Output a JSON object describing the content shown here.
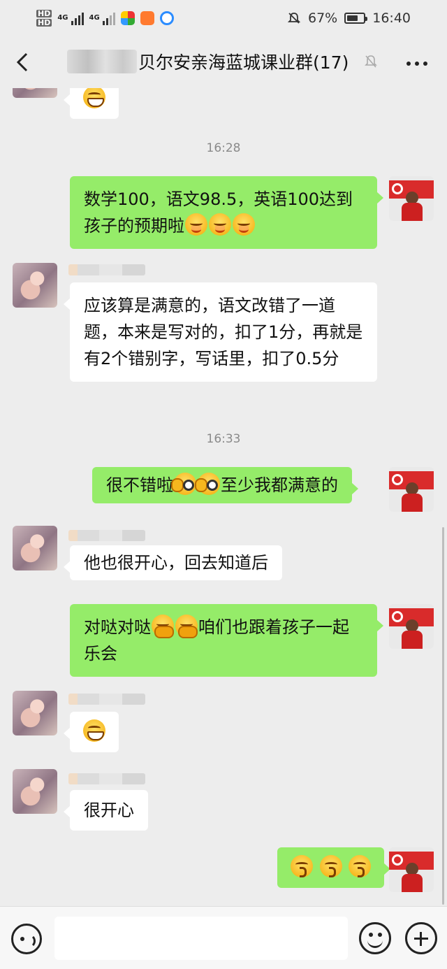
{
  "status_bar": {
    "battery": "67%",
    "time": "16:40",
    "network": "4G"
  },
  "header": {
    "title": "贝尔安亲海蓝城课业群(17)",
    "back_icon": "chevron-left-icon",
    "mute_icon": "bell-off-icon",
    "more_icon": "more-dots-icon"
  },
  "messages": [
    {
      "type": "emoji",
      "side": "in",
      "emoji": "grin"
    },
    {
      "type": "time",
      "text": "16:28"
    },
    {
      "type": "text",
      "side": "out",
      "text": "数学100，语文98.5，英语100达到孩子的预期啦",
      "emojis": [
        "smile",
        "smile",
        "smile"
      ]
    },
    {
      "type": "text",
      "side": "in",
      "text": "应该算是满意的，语文改错了一道题，本来是写对的，扣了1分，再就是有2个错别字，写话里，扣了0.5分"
    },
    {
      "type": "time",
      "text": "16:33"
    },
    {
      "type": "text",
      "side": "out",
      "text_before": "很不错啦",
      "emojis": [
        "wink",
        "wink"
      ],
      "text_after": "至少我都满意的"
    },
    {
      "type": "text",
      "side": "in",
      "text": "他也很开心，回去知道后"
    },
    {
      "type": "text",
      "side": "out",
      "text_before": "对哒对哒",
      "emojis": [
        "hug",
        "hug"
      ],
      "text_after": "咱们也跟着孩子一起乐会"
    },
    {
      "type": "emoji",
      "side": "in",
      "emoji": "grin"
    },
    {
      "type": "text",
      "side": "in",
      "text": "很开心"
    },
    {
      "type": "emoji",
      "side": "out",
      "emojis": [
        "kiss",
        "kiss",
        "kiss"
      ]
    }
  ],
  "input_bar": {
    "voice_icon": "voice-icon",
    "emoji_icon": "emoji-face-icon",
    "plus_icon": "plus-circle-icon"
  }
}
